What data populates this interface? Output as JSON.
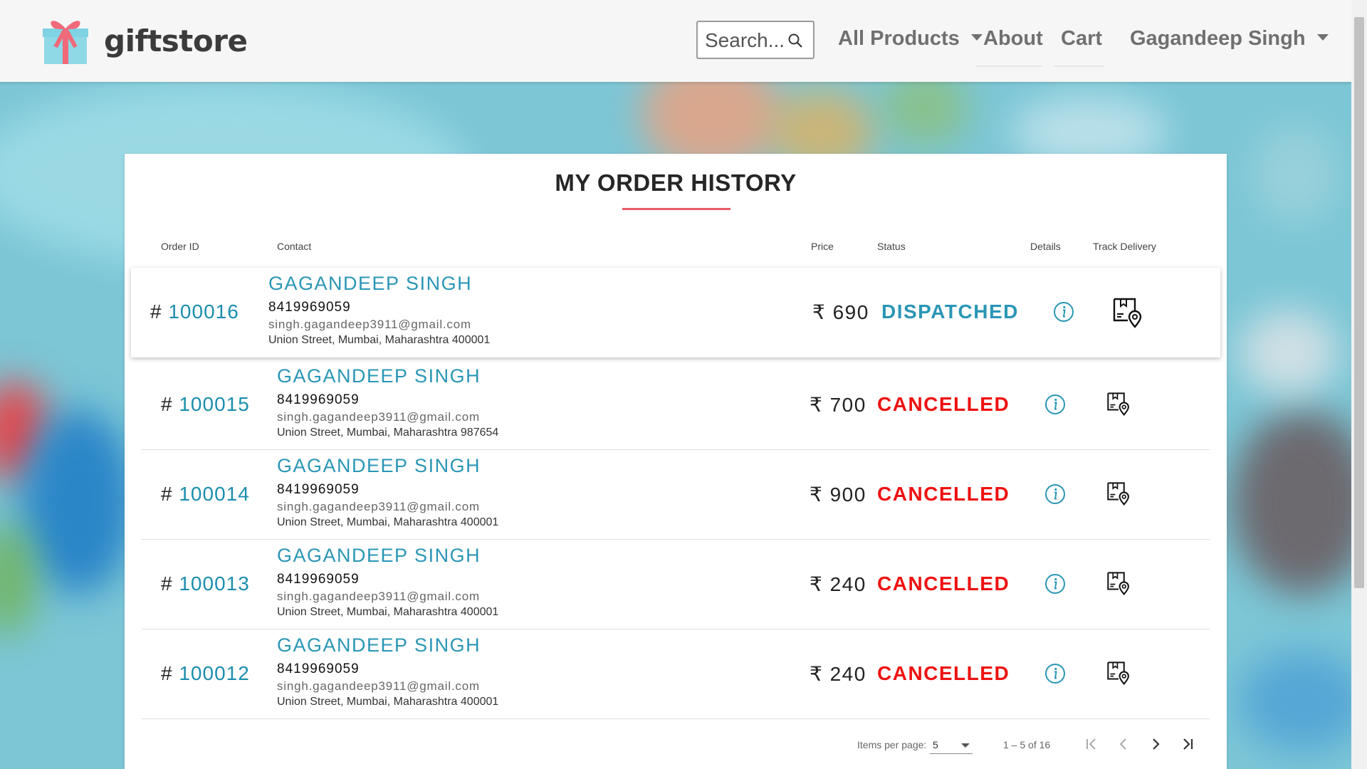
{
  "brand": {
    "name": "giftstore"
  },
  "search": {
    "placeholder": "Search..."
  },
  "nav": {
    "all_products": "All Products",
    "about": "About",
    "cart": "Cart",
    "user": "Gagandeep Singh"
  },
  "page": {
    "title": "MY ORDER HISTORY",
    "columns": {
      "order_id": "Order ID",
      "contact": "Contact",
      "price": "Price",
      "status": "Status",
      "details": "Details",
      "track": "Track Delivery"
    }
  },
  "orders": [
    {
      "hash": "#",
      "id": "100016",
      "name": "GAGANDEEP SINGH",
      "phone": "8419969059",
      "email": "singh.gagandeep3911@gmail.com",
      "address": "Union Street, Mumbai, Maharashtra 400001",
      "price": "₹ 690",
      "status": "DISPATCHED"
    },
    {
      "hash": "#",
      "id": "100015",
      "name": "GAGANDEEP SINGH",
      "phone": "8419969059",
      "email": "singh.gagandeep3911@gmail.com",
      "address": "Union Street, Mumbai, Maharashtra 987654",
      "price": "₹ 700",
      "status": "CANCELLED"
    },
    {
      "hash": "#",
      "id": "100014",
      "name": "GAGANDEEP SINGH",
      "phone": "8419969059",
      "email": "singh.gagandeep3911@gmail.com",
      "address": "Union Street, Mumbai, Maharashtra 400001",
      "price": "₹ 900",
      "status": "CANCELLED"
    },
    {
      "hash": "#",
      "id": "100013",
      "name": "GAGANDEEP SINGH",
      "phone": "8419969059",
      "email": "singh.gagandeep3911@gmail.com",
      "address": "Union Street, Mumbai, Maharashtra 400001",
      "price": "₹ 240",
      "status": "CANCELLED"
    },
    {
      "hash": "#",
      "id": "100012",
      "name": "GAGANDEEP SINGH",
      "phone": "8419969059",
      "email": "singh.gagandeep3911@gmail.com",
      "address": "Union Street, Mumbai, Maharashtra 400001",
      "price": "₹ 240",
      "status": "CANCELLED"
    }
  ],
  "paginator": {
    "items_per_page_label": "Items per page:",
    "page_size": "5",
    "range": "1 – 5 of 16"
  },
  "colors": {
    "accent": "#2a96b5",
    "cancelled": "#ee1111",
    "title_underline": "#e75b65",
    "logo_box": "#7fd3e3",
    "logo_ribbon": "#f06a7a"
  },
  "icons": {
    "logo": "gift-box-icon",
    "search": "search-icon",
    "details": "info-circle-icon",
    "track": "delivery-location-icon",
    "first_page": "first-page-icon",
    "prev_page": "chevron-left-icon",
    "next_page": "chevron-right-icon",
    "last_page": "last-page-icon"
  }
}
